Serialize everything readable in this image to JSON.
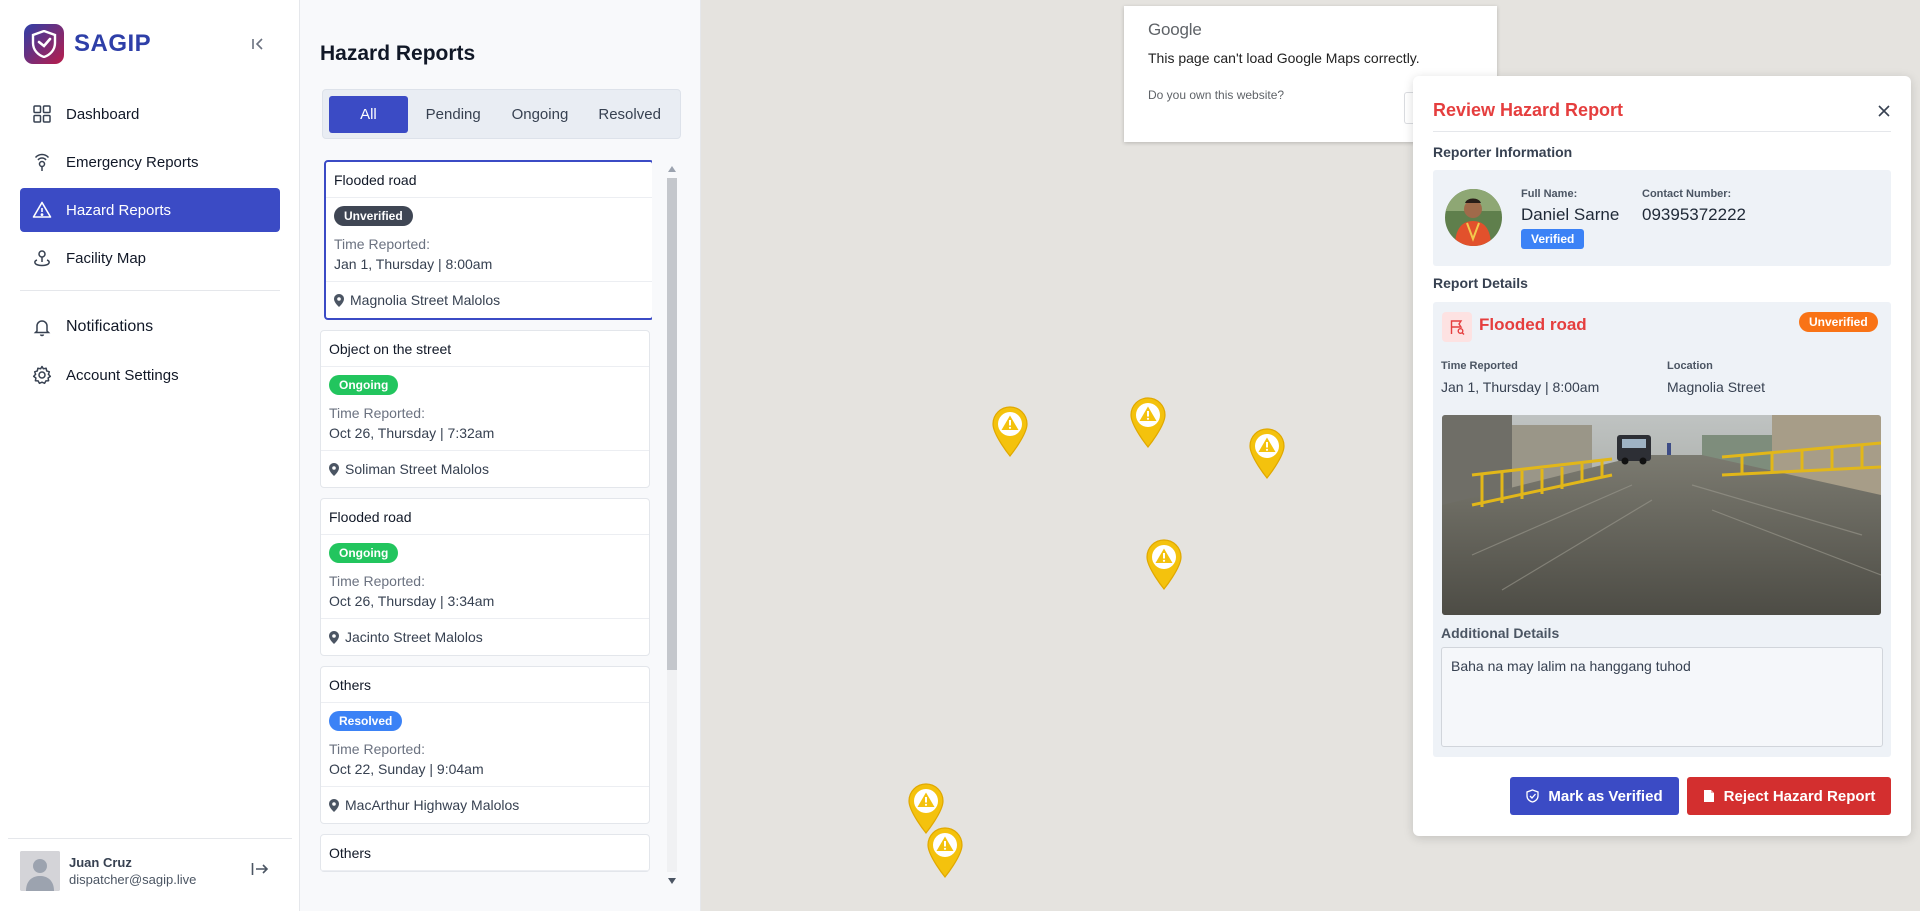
{
  "brand": {
    "name": "SAGIP"
  },
  "sidebar": {
    "items": [
      {
        "label": "Dashboard",
        "icon": "grid-icon"
      },
      {
        "label": "Emergency Reports",
        "icon": "signal-icon"
      },
      {
        "label": "Hazard Reports",
        "icon": "warning-icon"
      },
      {
        "label": "Facility Map",
        "icon": "map-pin-icon"
      }
    ],
    "notifications_label": "Notifications",
    "account_label": "Account Settings"
  },
  "user": {
    "name": "Juan Cruz",
    "email": "dispatcher@sagip.live"
  },
  "reports": {
    "title": "Hazard Reports",
    "tabs": [
      "All",
      "Pending",
      "Ongoing",
      "Resolved"
    ],
    "active_tab": "All",
    "time_label": "Time Reported:",
    "list": [
      {
        "title": "Flooded road",
        "status": "Unverified",
        "time": "Jan 1, Thursday | 8:00am",
        "location": "Magnolia Street Malolos"
      },
      {
        "title": "Object on the street",
        "status": "Ongoing",
        "time": "Oct 26, Thursday | 7:32am",
        "location": "Soliman Street Malolos"
      },
      {
        "title": "Flooded road",
        "status": "Ongoing",
        "time": "Oct 26, Thursday | 3:34am",
        "location": "Jacinto Street Malolos"
      },
      {
        "title": "Others",
        "status": "Resolved",
        "time": "Oct 22, Sunday | 9:04am",
        "location": "MacArthur Highway Malolos"
      },
      {
        "title": "Others",
        "status": "",
        "time": "",
        "location": ""
      }
    ]
  },
  "map_error": {
    "logo": "Google",
    "message": "This page can't load Google Maps correctly.",
    "own_site": "Do you own this website?"
  },
  "review": {
    "title": "Review Hazard Report",
    "reporter_section": "Reporter Information",
    "full_name_label": "Full Name:",
    "full_name": "Daniel Sarne",
    "reporter_badge": "Verified",
    "contact_label": "Contact Number:",
    "contact": "09395372222",
    "details_section": "Report Details",
    "hazard_title": "Flooded road",
    "hazard_status": "Unverified",
    "time_label": "Time Reported",
    "time_value": "Jan 1, Thursday | 8:00am",
    "location_label": "Location",
    "location_value": "Magnolia Street",
    "additional_label": "Additional Details",
    "additional_text": "Baha na may lalim na hanggang tuhod",
    "verify_button": "Mark as Verified",
    "reject_button": "Reject Hazard Report"
  },
  "colors": {
    "primary": "#3b4bc5",
    "danger": "#e53e3e",
    "unverified": "#3f4654",
    "ongoing": "#22c55e",
    "resolved": "#3b82f6",
    "pending_orange": "#f97316",
    "pin_yellow": "#f4c20d"
  }
}
